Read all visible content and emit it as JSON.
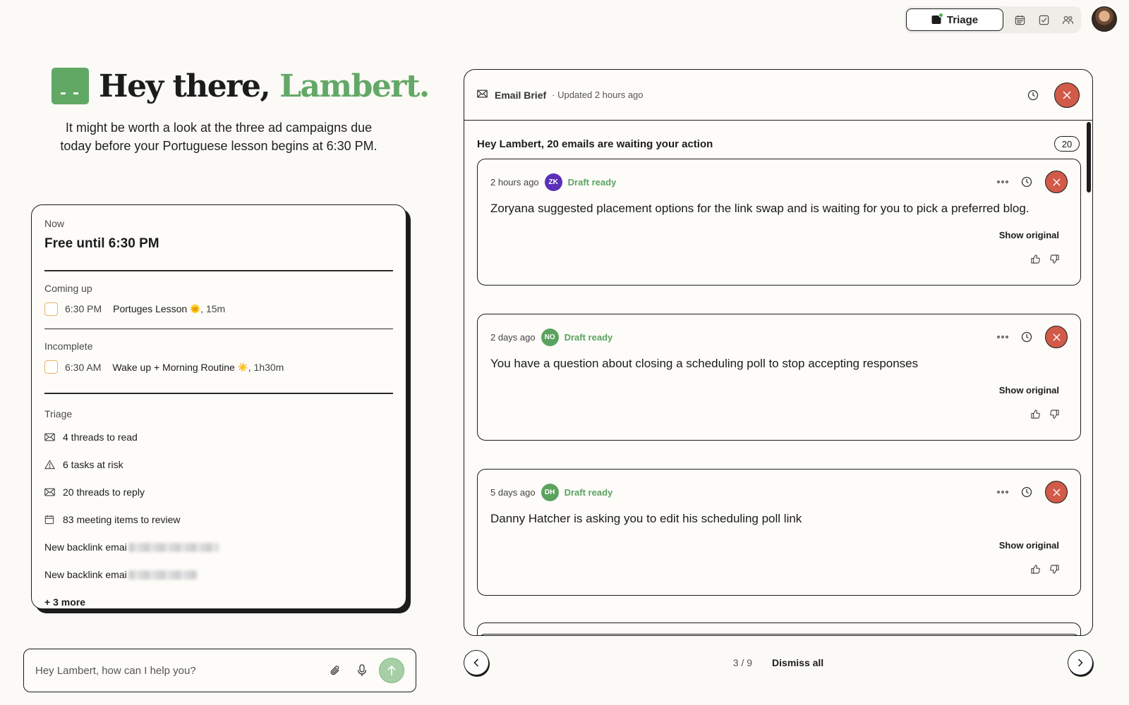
{
  "topbar": {
    "triage_label": "Triage",
    "icons": [
      "calendar-icon",
      "checkbox-icon",
      "people-icon"
    ]
  },
  "greeting": {
    "prefix": "Hey there,",
    "name": "Lambert.",
    "subtitle": "It might be worth a look at the three ad campaigns due today before your Portuguese lesson begins at 6:30 PM."
  },
  "schedule": {
    "now_label": "Now",
    "now_title": "Free until 6:30 PM",
    "coming_up_label": "Coming up",
    "coming_up": [
      {
        "time": "6:30 PM",
        "title": "Portuges Lesson",
        "emoji": "🌞",
        "duration": ", 15m"
      }
    ],
    "incomplete_label": "Incomplete",
    "incomplete": [
      {
        "time": "6:30 AM",
        "title": "Wake up + Morning Routine",
        "emoji": "☀️",
        "duration": ", 1h30m"
      }
    ],
    "triage_label": "Triage",
    "triage_items": [
      {
        "icon": "mail-icon",
        "text": "4 threads to read"
      },
      {
        "icon": "warning-icon",
        "text": "6 tasks at risk"
      },
      {
        "icon": "mail-icon",
        "text": "20 threads to reply"
      },
      {
        "icon": "calendar-icon",
        "text": "83 meeting items to review"
      }
    ],
    "blurred_items": [
      "New backlink emai",
      "New backlink emai"
    ],
    "more": "+ 3 more"
  },
  "chat": {
    "placeholder": "Hey Lambert, how can I help you?"
  },
  "brief": {
    "title": "Email Brief",
    "updated": "· Updated 2 hours ago",
    "waiting_text": "Hey Lambert, 20 emails are waiting your action",
    "count": "20",
    "emails": [
      {
        "ago": "2 hours ago",
        "initials": "ZK",
        "badge_color": "#5b2fb8",
        "status": "Draft ready",
        "summary": "Zoryana suggested placement options for the link swap and is waiting for you to pick a preferred blog.",
        "show_original": "Show original"
      },
      {
        "ago": "2 days ago",
        "initials": "NO",
        "badge_color": "#5aa35f",
        "status": "Draft ready",
        "summary": "You have a question about closing a scheduling poll to stop accepting responses",
        "show_original": "Show original"
      },
      {
        "ago": "5 days ago",
        "initials": "DH",
        "badge_color": "#5aa35f",
        "status": "Draft ready",
        "summary": "Danny Hatcher is asking you to edit his scheduling poll link",
        "show_original": "Show original"
      }
    ]
  },
  "pager": {
    "page": "3 / 9",
    "dismiss_all": "Dismiss all"
  },
  "colors": {
    "accent_green": "#63a867",
    "close_red": "#d15a48",
    "background": "#fbfaf6"
  }
}
